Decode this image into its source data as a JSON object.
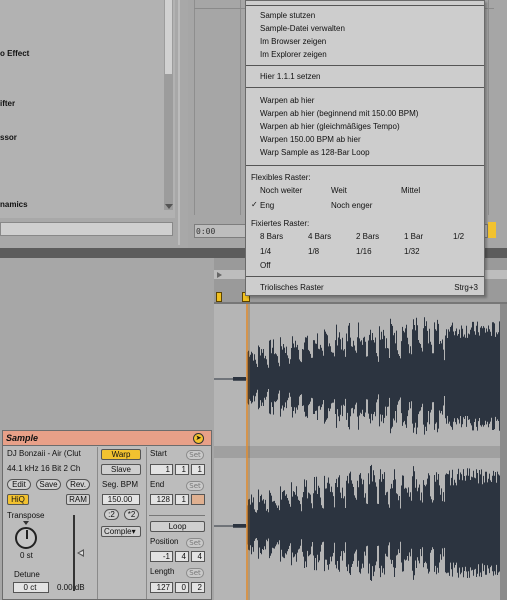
{
  "browser": {
    "items": [
      "o Effect",
      "ifter",
      "ssor",
      "namics"
    ]
  },
  "arrangement": {
    "time_display": "0:00"
  },
  "sample_view": {
    "title": "Sample",
    "file_name": "DJ Bonzaii - Air (Clut",
    "file_info": "44.1 kHz 16 Bit 2 Ch",
    "buttons": {
      "edit": "Edit",
      "save": "Save",
      "rev": "Rev.",
      "hiq": "HiQ",
      "ram": "RAM"
    },
    "transpose": {
      "label": "Transpose",
      "value": "0 st"
    },
    "detune": {
      "label": "Detune",
      "value": "0 ct"
    },
    "volume_value": "0.00 dB",
    "warp": {
      "warp_label": "Warp",
      "slave_label": "Slave",
      "seg_bpm_label": "Seg. BPM",
      "seg_bpm_value": "150.00",
      "half_label": ":2",
      "double_label": "*2",
      "mode": "Comple▾"
    },
    "start": {
      "label": "Start",
      "set": "Set",
      "bars": "1",
      "beats": "1",
      "sixteenths": "1"
    },
    "end": {
      "label": "End",
      "set": "Set",
      "bars": "128",
      "beats": "1",
      "sixteenths": ""
    },
    "loop_label": "Loop",
    "position": {
      "label": "Position",
      "set": "Set",
      "bars": "-1",
      "beats": "4",
      "sixteenths": "4"
    },
    "length": {
      "label": "Length",
      "set": "Set",
      "bars": "127",
      "beats": "0",
      "sixteenths": "2"
    }
  },
  "context_menu": {
    "group1": [
      "Sample stutzen",
      "Sample-Datei verwalten",
      "Im Browser zeigen",
      "Im Explorer zeigen"
    ],
    "group2": [
      "Hier 1.1.1 setzen"
    ],
    "group3": [
      "Warpen ab hier",
      "Warpen ab hier (beginnend mit 150.00 BPM)",
      "Warpen ab hier (gleichmäßiges Tempo)",
      "Warpen 150.00 BPM ab hier",
      "Warp Sample as 128-Bar Loop"
    ],
    "flex_grid": {
      "heading": "Flexibles Raster:",
      "options": [
        "Noch weiter",
        "Weit",
        "Mittel",
        "Eng",
        "Noch enger"
      ],
      "checked": "✓"
    },
    "fixed_grid": {
      "heading": "Fixiertes Raster:",
      "row1": [
        "8 Bars",
        "4 Bars",
        "2 Bars",
        "1 Bar",
        "1/2"
      ],
      "row2": [
        "1/4",
        "1/8",
        "1/16",
        "1/32"
      ],
      "row3": [
        "Off"
      ]
    },
    "triplet": {
      "label": "Triolisches Raster",
      "shortcut": "Strg+3"
    }
  }
}
